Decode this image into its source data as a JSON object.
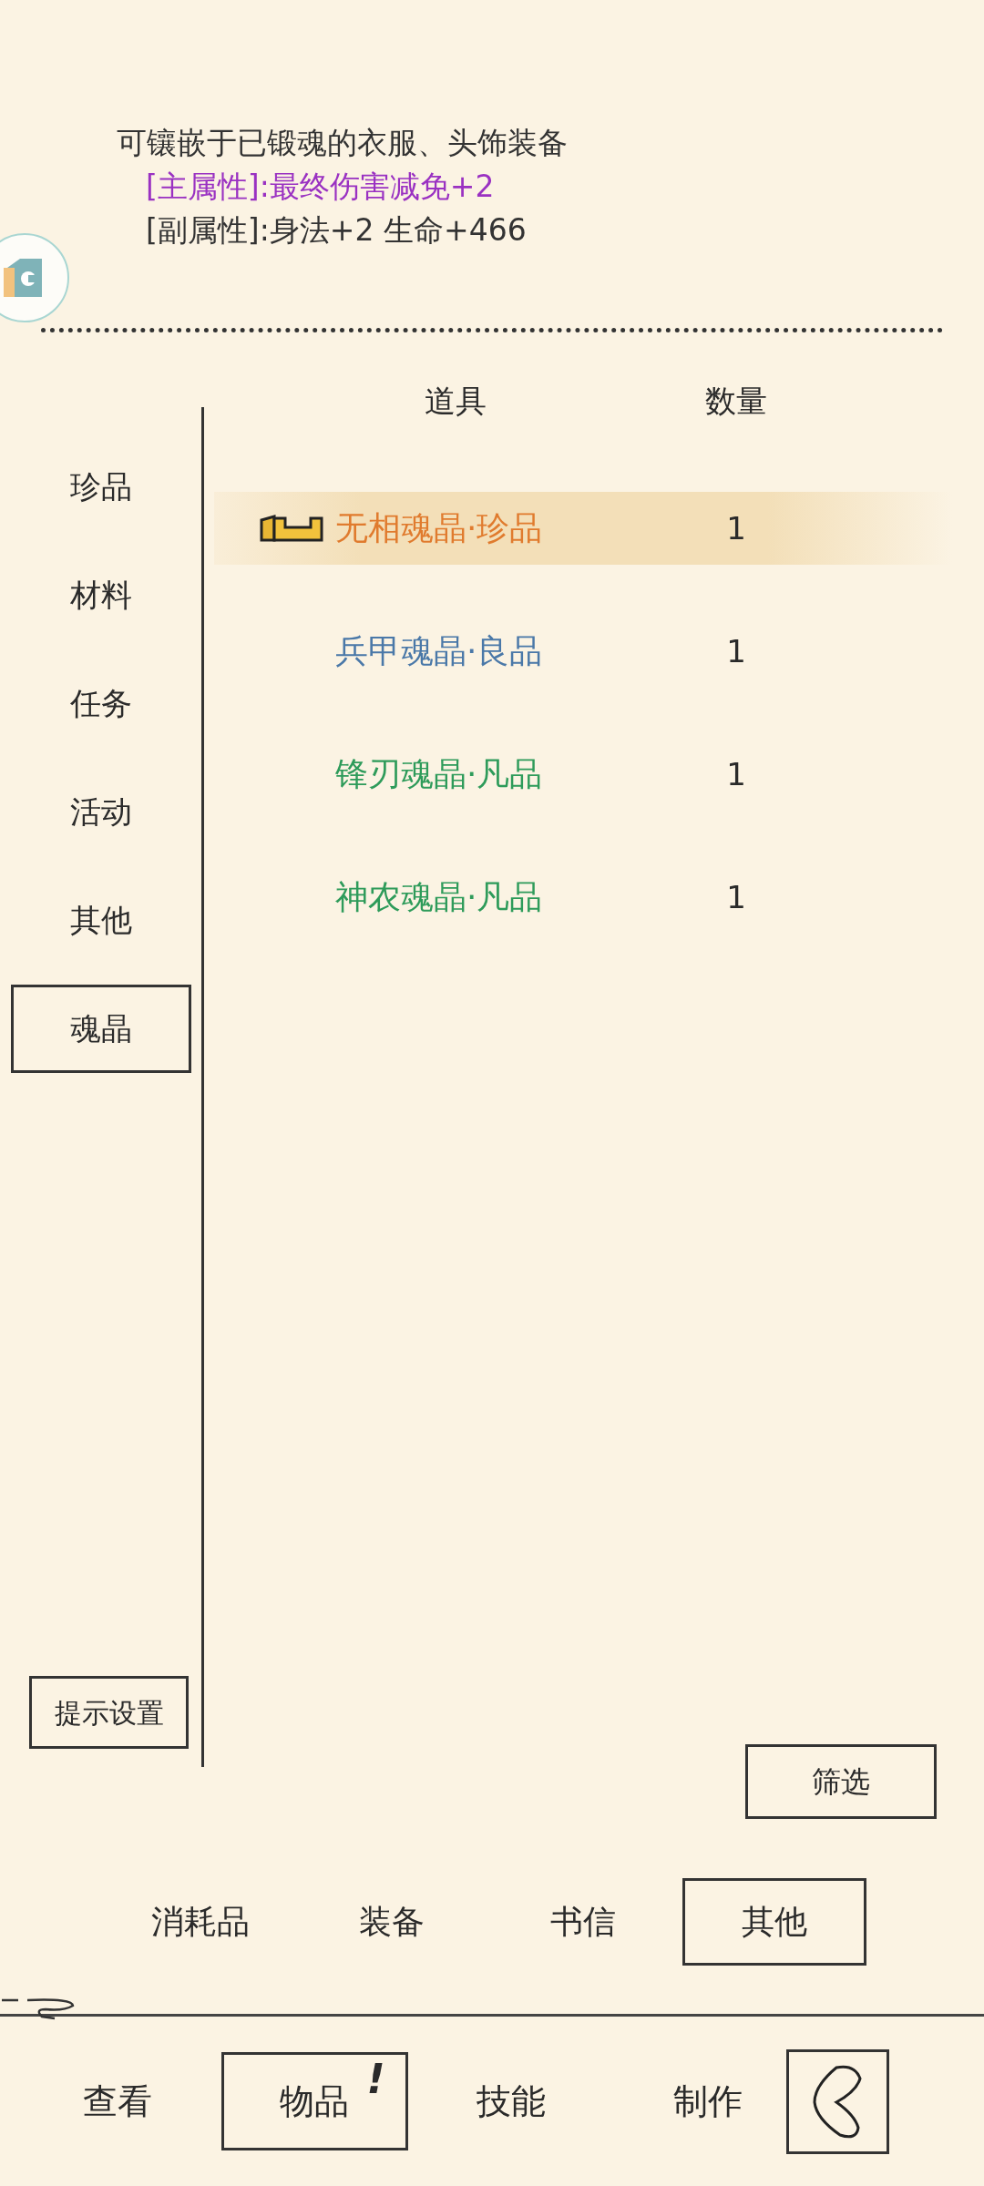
{
  "description": [
    {
      "text": "可镶嵌于已锻魂的衣服、头饰装备",
      "color": "#333333"
    },
    {
      "text": "[主属性]:最终伤害减免+2",
      "color": "#9a31c2"
    },
    {
      "text": "[副属性]:身法+2 生命+466",
      "color": "#333333"
    }
  ],
  "sidebar": {
    "items": [
      {
        "label": "珍品",
        "selected": false
      },
      {
        "label": "材料",
        "selected": false
      },
      {
        "label": "任务",
        "selected": false
      },
      {
        "label": "活动",
        "selected": false
      },
      {
        "label": "其他",
        "selected": false
      },
      {
        "label": "魂晶",
        "selected": true
      }
    ],
    "settings_button": "提示设置"
  },
  "table": {
    "columns": [
      "道具",
      "数量"
    ],
    "rows": [
      {
        "name": "无相魂晶·珍品",
        "count": "1",
        "color": "#e07b2e",
        "selected": true,
        "kind": "flagged"
      },
      {
        "name": "兵甲魂晶·良品",
        "count": "1",
        "color": "#4a78a8",
        "selected": false,
        "kind": "plain"
      },
      {
        "name": "锋刃魂晶·凡品",
        "count": "1",
        "color": "#2e9b5a",
        "selected": false,
        "kind": "plain"
      },
      {
        "name": "神农魂晶·凡品",
        "count": "1",
        "color": "#2e9b5a",
        "selected": false,
        "kind": "plain"
      }
    ]
  },
  "filter_button": "筛选",
  "category_tabs": [
    {
      "label": "消耗品",
      "selected": false
    },
    {
      "label": "装备",
      "selected": false
    },
    {
      "label": "书信",
      "selected": false
    },
    {
      "label": "其他",
      "selected": true
    }
  ],
  "nav_tabs": [
    {
      "label": "查看",
      "selected": false
    },
    {
      "label": "物品",
      "selected": true,
      "badge": "!"
    },
    {
      "label": "技能",
      "selected": false
    },
    {
      "label": "制作",
      "selected": false
    }
  ]
}
